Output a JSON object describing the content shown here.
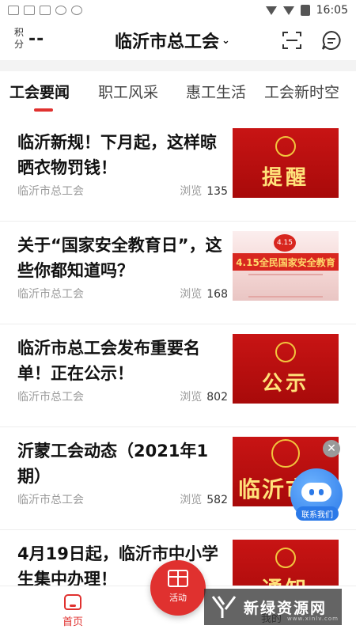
{
  "statusbar": {
    "time": "16:05"
  },
  "header": {
    "points_label": "积分",
    "points_value": "--",
    "city": "临沂市总工会",
    "city_chevron": "⌄"
  },
  "tabs": [
    {
      "label": "工会要闻",
      "active": true
    },
    {
      "label": "职工风采",
      "active": false
    },
    {
      "label": "惠工生活",
      "active": false
    },
    {
      "label": "工会新时空",
      "active": false
    }
  ],
  "feed": {
    "views_label": "浏览",
    "items": [
      {
        "title": "临沂新规！下月起，这样晾晒衣物罚钱！",
        "source": "临沂市总工会",
        "views": "135",
        "thumb_text": "提醒"
      },
      {
        "title": "关于“国家安全教育日”，这些你都知道吗？",
        "source": "临沂市总工会",
        "views": "168",
        "thumb_text": "4.15全民国家安全教育",
        "thumb_badge": "4.15"
      },
      {
        "title": "临沂市总工会发布重要名单！正在公示！",
        "source": "临沂市总工会",
        "views": "802",
        "thumb_text": "公示"
      },
      {
        "title": "沂蒙工会动态（2021年1期）",
        "source": "临沂市总工会",
        "views": "582",
        "thumb_text": "临沂市总"
      },
      {
        "title": "4月19日起，临沂市中小学生集中办理！",
        "source": "",
        "views": "",
        "thumb_text": "通知"
      }
    ]
  },
  "overlay": {
    "close": "✕",
    "robot_label": "联系我们"
  },
  "bottomnav": {
    "home": "首页",
    "activity": "活动",
    "mine": "我的"
  },
  "watermark": {
    "text": "新绿资源网",
    "sub": "www.xinlv.com"
  },
  "colors": {
    "accent": "#e0312f",
    "thumb_red": "#c81414",
    "thumb_gold": "#ffe27a"
  }
}
